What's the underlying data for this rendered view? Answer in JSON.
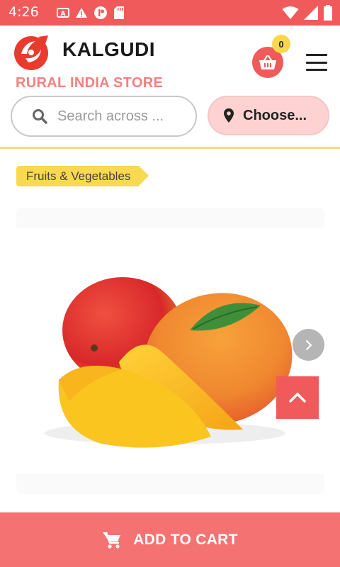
{
  "status_bar": {
    "time": "4:26",
    "left_icons": [
      "autofill-icon",
      "warning-icon",
      "info-icon",
      "sd-card-icon"
    ],
    "right_icons": [
      "wifi-icon",
      "signal-icon",
      "battery-icon"
    ]
  },
  "header": {
    "brand": "KALGUDI",
    "tagline": "RURAL INDIA STORE",
    "cart_count": "0",
    "cart_icon": "shopping-basket-icon",
    "menu_icon": "hamburger-menu-icon"
  },
  "search": {
    "placeholder": "Search across ..."
  },
  "location": {
    "label": "Choose..."
  },
  "product": {
    "category": "Fruits & Vegetables",
    "image_subject": "mango"
  },
  "actions": {
    "add_to_cart": "ADD TO CART"
  },
  "colors": {
    "primary": "#f05a5a",
    "accent_yellow": "#f8d94f",
    "tagline": "#f58080",
    "location_bg": "#ffd2d2"
  }
}
